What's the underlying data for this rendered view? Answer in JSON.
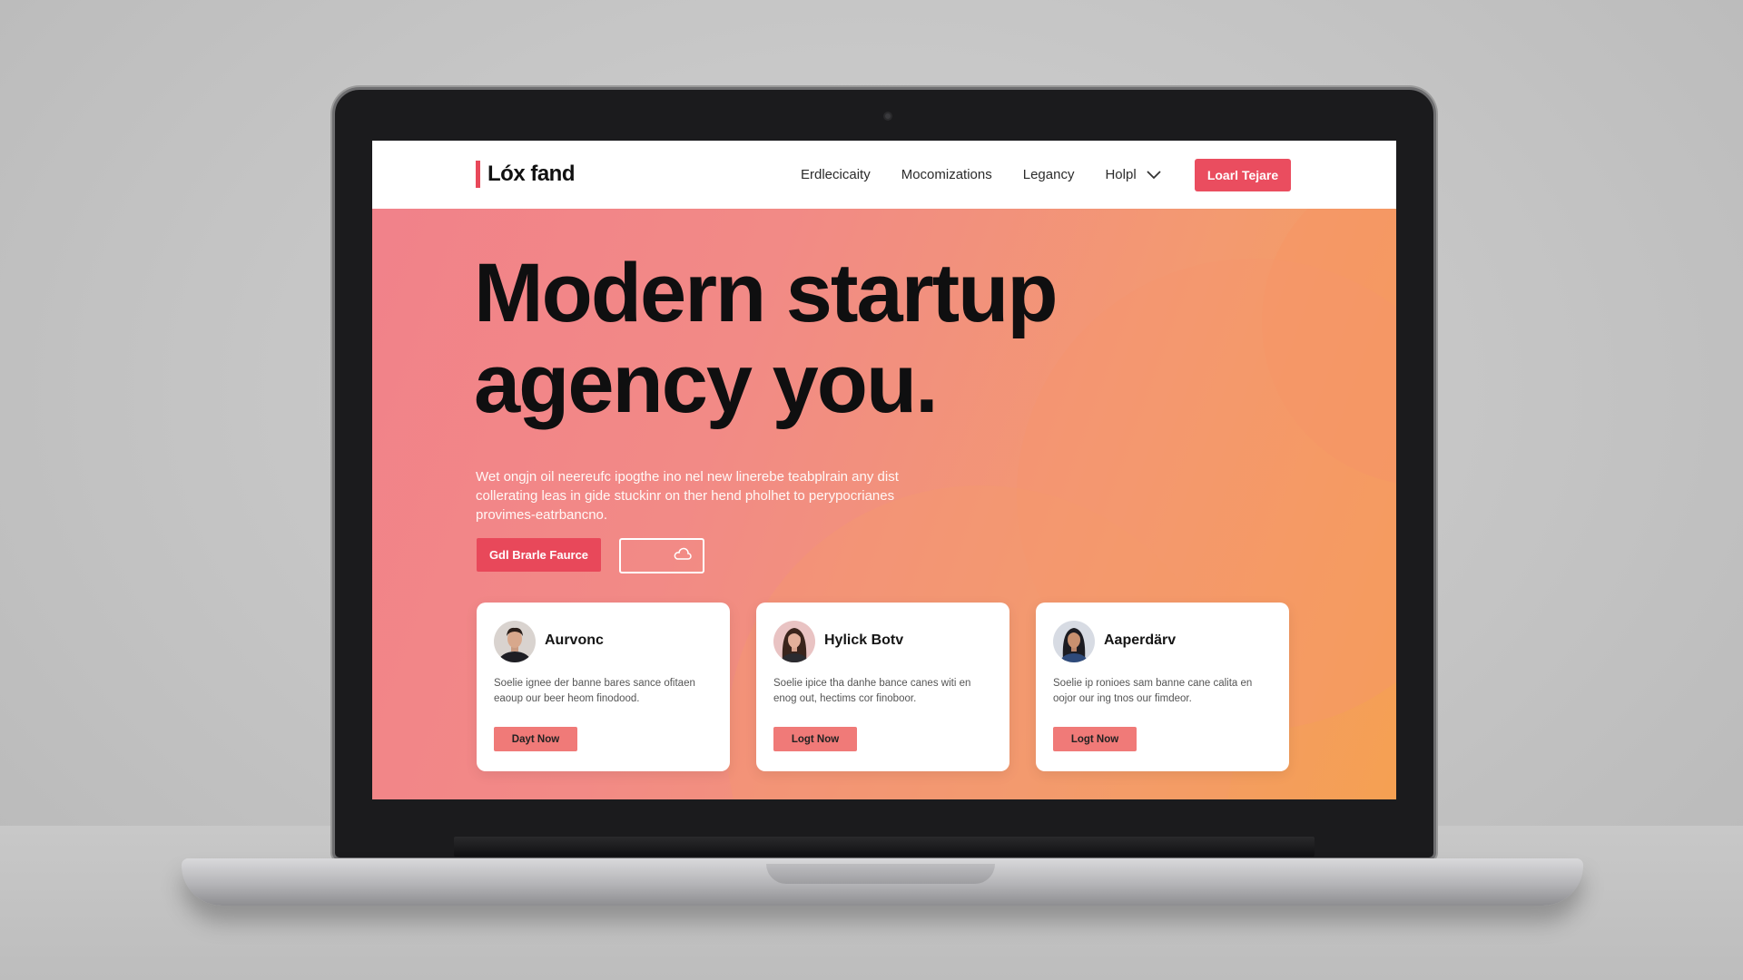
{
  "colors": {
    "accent": "#e8485a",
    "hero_gradient_start": "#f1818a",
    "hero_gradient_end": "#f5a052",
    "card_button": "#f07a78"
  },
  "navbar": {
    "brand": "Lóx fand",
    "links": [
      "Erdlecicaity",
      "Mocomizations",
      "Legancy",
      "Holpl"
    ],
    "cta": "Loarl Tejare"
  },
  "hero": {
    "title_lines": [
      "Modern startup",
      "agency you."
    ],
    "description_lines": [
      "Wet ongjn oil neereufc ipogthe ino nel new linerebe teabplrain any dist",
      "collerating leas in gide stuckinr on ther hend pholhet to perypocrianes",
      "provimes-eatrbancno."
    ],
    "primary_button": "Gdl Brarle Faurce",
    "secondary_button_icon": "cloud-icon"
  },
  "cards": [
    {
      "name": "Aurvonc",
      "text_lines": [
        "Soelie ignee der banne bares sance ofitaen",
        "eaoup our beer heom finodood."
      ],
      "button": "Dayt Now",
      "avatar": "man-avatar"
    },
    {
      "name": "Hylick Botv",
      "text_lines": [
        "Soelie ipice tha danhe bance canes witi en",
        "enog out, hectims cor finoboor."
      ],
      "button": "Logt Now",
      "avatar": "woman-avatar"
    },
    {
      "name": "Aaperdärv",
      "text_lines": [
        "Soelie ip ronioes sam banne cane calita en",
        "oojor our ing tnos our fimdeor."
      ],
      "button": "Logt Now",
      "avatar": "woman-avatar"
    }
  ]
}
